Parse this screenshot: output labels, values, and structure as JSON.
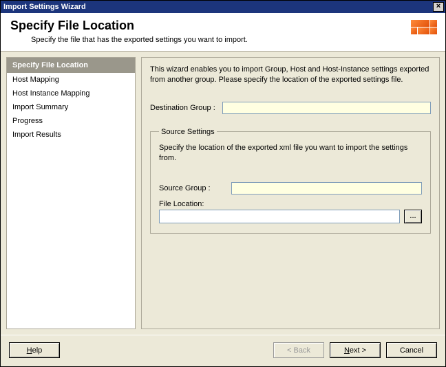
{
  "window": {
    "title": "Import Settings Wizard"
  },
  "header": {
    "title": "Specify File Location",
    "subtitle": "Specify the file that has the exported settings you want to import."
  },
  "sidebar": {
    "items": [
      {
        "label": "Specify File Location",
        "active": true
      },
      {
        "label": "Host Mapping",
        "active": false
      },
      {
        "label": "Host Instance Mapping",
        "active": false
      },
      {
        "label": "Import Summary",
        "active": false
      },
      {
        "label": "Progress",
        "active": false
      },
      {
        "label": "Import Results",
        "active": false
      }
    ]
  },
  "main": {
    "intro": "This wizard enables you to import Group, Host and Host-Instance settings exported from another group. Please specify the location of the exported settings file.",
    "destination_group_label": "Destination Group :",
    "destination_group_value": "",
    "source_settings": {
      "legend": "Source Settings",
      "help": "Specify the location of the exported xml file you want to import the settings from.",
      "source_group_label": "Source Group :",
      "source_group_value": "",
      "file_location_label": "File Location:",
      "file_location_value": "",
      "browse_label": "..."
    }
  },
  "footer": {
    "help": "Help",
    "back": "< Back",
    "next": "Next >",
    "cancel": "Cancel"
  }
}
